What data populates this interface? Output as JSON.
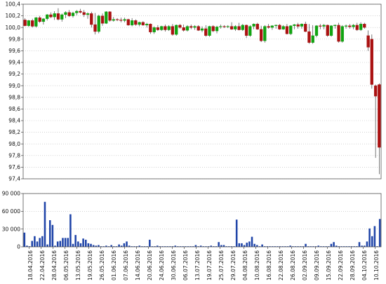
{
  "chart_data": [
    {
      "type": "candlestick",
      "ylim": [
        97.4,
        100.4
      ],
      "yticks": [
        "97,4",
        "97,6",
        "97,8",
        "98,0",
        "98,2",
        "98,4",
        "98,6",
        "98,8",
        "99,0",
        "99,2",
        "99,4",
        "99,6",
        "99,8",
        "100,0",
        "100,2",
        "100,4"
      ],
      "grid": true,
      "up_color": "#11a311",
      "down_color": "#aa1111",
      "candles": [
        {
          "o": 100.13,
          "h": 100.16,
          "l": 100.02,
          "c": 100.03
        },
        {
          "o": 100.03,
          "h": 100.13,
          "l": 100.01,
          "c": 100.12
        },
        {
          "o": 100.12,
          "h": 100.15,
          "l": 100.0,
          "c": 100.02
        },
        {
          "o": 100.02,
          "h": 100.18,
          "l": 100.0,
          "c": 100.17
        },
        {
          "o": 100.17,
          "h": 100.2,
          "l": 100.08,
          "c": 100.1
        },
        {
          "o": 100.1,
          "h": 100.16,
          "l": 100.05,
          "c": 100.15
        },
        {
          "o": 100.15,
          "h": 100.23,
          "l": 100.12,
          "c": 100.22
        },
        {
          "o": 100.22,
          "h": 100.26,
          "l": 100.16,
          "c": 100.18
        },
        {
          "o": 100.18,
          "h": 100.28,
          "l": 100.13,
          "c": 100.24
        },
        {
          "o": 100.24,
          "h": 100.33,
          "l": 100.12,
          "c": 100.14
        },
        {
          "o": 100.14,
          "h": 100.24,
          "l": 100.1,
          "c": 100.22
        },
        {
          "o": 100.22,
          "h": 100.28,
          "l": 100.16,
          "c": 100.26
        },
        {
          "o": 100.26,
          "h": 100.3,
          "l": 100.18,
          "c": 100.2
        },
        {
          "o": 100.2,
          "h": 100.27,
          "l": 100.17,
          "c": 100.25
        },
        {
          "o": 100.25,
          "h": 100.3,
          "l": 100.21,
          "c": 100.28
        },
        {
          "o": 100.28,
          "h": 100.32,
          "l": 100.24,
          "c": 100.26
        },
        {
          "o": 100.26,
          "h": 100.3,
          "l": 100.18,
          "c": 100.22
        },
        {
          "o": 100.22,
          "h": 100.26,
          "l": 100.15,
          "c": 100.24
        },
        {
          "o": 100.24,
          "h": 100.27,
          "l": 100.0,
          "c": 100.05
        },
        {
          "o": 100.05,
          "h": 100.25,
          "l": 99.88,
          "c": 99.93
        },
        {
          "o": 99.93,
          "h": 100.22,
          "l": 99.9,
          "c": 100.2
        },
        {
          "o": 100.2,
          "h": 100.24,
          "l": 100.03,
          "c": 100.07
        },
        {
          "o": 100.07,
          "h": 100.28,
          "l": 100.06,
          "c": 100.27
        },
        {
          "o": 100.27,
          "h": 100.28,
          "l": 100.1,
          "c": 100.12
        },
        {
          "o": 100.12,
          "h": 100.18,
          "l": 100.1,
          "c": 100.14
        },
        {
          "o": 100.14,
          "h": 100.16,
          "l": 100.11,
          "c": 100.13
        },
        {
          "o": 100.13,
          "h": 100.17,
          "l": 100.09,
          "c": 100.12
        },
        {
          "o": 100.12,
          "h": 100.17,
          "l": 100.09,
          "c": 100.14
        },
        {
          "o": 100.14,
          "h": 100.15,
          "l": 100.03,
          "c": 100.04
        },
        {
          "o": 100.04,
          "h": 100.16,
          "l": 100.02,
          "c": 100.12
        },
        {
          "o": 100.12,
          "h": 100.14,
          "l": 100.03,
          "c": 100.05
        },
        {
          "o": 100.05,
          "h": 100.1,
          "l": 100.02,
          "c": 100.09
        },
        {
          "o": 100.09,
          "h": 100.11,
          "l": 100.03,
          "c": 100.04
        },
        {
          "o": 100.04,
          "h": 100.08,
          "l": 100.0,
          "c": 100.06
        },
        {
          "o": 100.06,
          "h": 100.07,
          "l": 99.89,
          "c": 99.92
        },
        {
          "o": 99.92,
          "h": 100.02,
          "l": 99.89,
          "c": 100.0
        },
        {
          "o": 100.0,
          "h": 100.04,
          "l": 99.94,
          "c": 99.96
        },
        {
          "o": 99.96,
          "h": 100.03,
          "l": 99.94,
          "c": 100.02
        },
        {
          "o": 100.02,
          "h": 100.05,
          "l": 99.93,
          "c": 99.96
        },
        {
          "o": 99.96,
          "h": 100.04,
          "l": 99.94,
          "c": 100.02
        },
        {
          "o": 100.02,
          "h": 100.06,
          "l": 99.86,
          "c": 99.88
        },
        {
          "o": 99.88,
          "h": 100.05,
          "l": 99.86,
          "c": 100.04
        },
        {
          "o": 100.04,
          "h": 100.06,
          "l": 99.98,
          "c": 100.0
        },
        {
          "o": 100.0,
          "h": 100.05,
          "l": 99.93,
          "c": 99.95
        },
        {
          "o": 99.95,
          "h": 100.04,
          "l": 99.93,
          "c": 100.02
        },
        {
          "o": 100.02,
          "h": 100.05,
          "l": 99.97,
          "c": 100.0
        },
        {
          "o": 100.0,
          "h": 100.04,
          "l": 99.96,
          "c": 100.02
        },
        {
          "o": 100.02,
          "h": 100.04,
          "l": 99.94,
          "c": 99.95
        },
        {
          "o": 99.95,
          "h": 100.02,
          "l": 99.92,
          "c": 99.98
        },
        {
          "o": 99.98,
          "h": 100.04,
          "l": 99.84,
          "c": 99.86
        },
        {
          "o": 99.86,
          "h": 100.03,
          "l": 99.84,
          "c": 100.02
        },
        {
          "o": 100.02,
          "h": 100.04,
          "l": 99.92,
          "c": 99.94
        },
        {
          "o": 99.94,
          "h": 100.03,
          "l": 99.9,
          "c": 100.01
        },
        {
          "o": 100.01,
          "h": 100.05,
          "l": 99.98,
          "c": 100.02
        },
        {
          "o": 100.02,
          "h": 100.04,
          "l": 99.99,
          "c": 100.01
        },
        {
          "o": 100.01,
          "h": 100.04,
          "l": 99.99,
          "c": 100.02
        },
        {
          "o": 100.02,
          "h": 100.09,
          "l": 99.96,
          "c": 99.97
        },
        {
          "o": 99.97,
          "h": 100.04,
          "l": 99.94,
          "c": 100.02
        },
        {
          "o": 100.02,
          "h": 100.08,
          "l": 99.95,
          "c": 99.96
        },
        {
          "o": 99.96,
          "h": 100.06,
          "l": 99.94,
          "c": 100.04
        },
        {
          "o": 100.04,
          "h": 100.05,
          "l": 99.82,
          "c": 99.86
        },
        {
          "o": 99.86,
          "h": 100.04,
          "l": 99.84,
          "c": 100.02
        },
        {
          "o": 100.02,
          "h": 100.07,
          "l": 99.97,
          "c": 100.06
        },
        {
          "o": 100.06,
          "h": 100.08,
          "l": 99.96,
          "c": 99.97
        },
        {
          "o": 99.97,
          "h": 100.03,
          "l": 99.75,
          "c": 99.77
        },
        {
          "o": 99.77,
          "h": 100.04,
          "l": 99.74,
          "c": 100.02
        },
        {
          "o": 100.02,
          "h": 100.06,
          "l": 99.98,
          "c": 100.0
        },
        {
          "o": 100.0,
          "h": 100.04,
          "l": 99.96,
          "c": 100.03
        },
        {
          "o": 100.03,
          "h": 100.05,
          "l": 99.98,
          "c": 100.04
        },
        {
          "o": 100.04,
          "h": 100.06,
          "l": 99.96,
          "c": 99.97
        },
        {
          "o": 99.97,
          "h": 100.04,
          "l": 99.96,
          "c": 100.02
        },
        {
          "o": 100.02,
          "h": 100.06,
          "l": 99.88,
          "c": 99.89
        },
        {
          "o": 99.89,
          "h": 100.04,
          "l": 99.87,
          "c": 100.03
        },
        {
          "o": 100.03,
          "h": 100.06,
          "l": 99.97,
          "c": 100.05
        },
        {
          "o": 100.05,
          "h": 100.08,
          "l": 99.98,
          "c": 100.02
        },
        {
          "o": 100.02,
          "h": 100.07,
          "l": 99.98,
          "c": 100.06
        },
        {
          "o": 100.06,
          "h": 100.1,
          "l": 99.92,
          "c": 99.93
        },
        {
          "o": 99.93,
          "h": 100.06,
          "l": 99.72,
          "c": 99.74
        },
        {
          "o": 99.74,
          "h": 100.04,
          "l": 99.72,
          "c": 99.86
        },
        {
          "o": 99.86,
          "h": 100.04,
          "l": 99.83,
          "c": 100.03
        },
        {
          "o": 100.03,
          "h": 100.06,
          "l": 99.97,
          "c": 100.02
        },
        {
          "o": 100.02,
          "h": 100.06,
          "l": 99.97,
          "c": 100.04
        },
        {
          "o": 100.04,
          "h": 100.05,
          "l": 99.84,
          "c": 99.86
        },
        {
          "o": 99.86,
          "h": 100.04,
          "l": 99.84,
          "c": 100.03
        },
        {
          "o": 100.03,
          "h": 100.05,
          "l": 99.98,
          "c": 100.04
        },
        {
          "o": 100.04,
          "h": 100.08,
          "l": 99.74,
          "c": 99.76
        },
        {
          "o": 99.76,
          "h": 100.04,
          "l": 99.74,
          "c": 100.02
        },
        {
          "o": 100.02,
          "h": 100.05,
          "l": 99.98,
          "c": 100.03
        },
        {
          "o": 100.03,
          "h": 100.06,
          "l": 99.98,
          "c": 100.01
        },
        {
          "o": 100.01,
          "h": 100.06,
          "l": 99.97,
          "c": 100.04
        },
        {
          "o": 100.04,
          "h": 100.08,
          "l": 99.94,
          "c": 99.96
        },
        {
          "o": 99.96,
          "h": 100.09,
          "l": 99.94,
          "c": 100.06
        },
        {
          "o": 100.06,
          "h": 100.08,
          "l": 99.98,
          "c": 100.0
        },
        {
          "o": 99.86,
          "h": 99.95,
          "l": 99.6,
          "c": 99.66
        },
        {
          "o": 99.8,
          "h": 99.88,
          "l": 98.95,
          "c": 99.02
        },
        {
          "o": 99.0,
          "h": 99.02,
          "l": 97.76,
          "c": 98.82
        },
        {
          "o": 99.02,
          "h": 99.04,
          "l": 97.48,
          "c": 97.94
        }
      ]
    },
    {
      "type": "bar",
      "ylim": [
        0,
        90000
      ],
      "yticks": [
        "0",
        "30 000",
        "60 000",
        "90 000"
      ],
      "grid": true,
      "bar_color": "#1f44a8",
      "values": [
        24000,
        2000,
        1000,
        10000,
        18000,
        9000,
        15000,
        18000,
        76000,
        4000,
        45000,
        37000,
        2000,
        9000,
        10000,
        15000,
        15000,
        15000,
        55000,
        5000,
        20000,
        9000,
        6000,
        14000,
        12000,
        6000,
        5000,
        3000,
        2000,
        3000,
        1000,
        1000,
        2000,
        1000,
        3000,
        1000,
        1000,
        4000,
        2000,
        6000,
        9000,
        2000,
        1000,
        1000,
        1000,
        2000,
        1000,
        1000,
        1000,
        12000,
        1000,
        1000,
        2000,
        1000,
        1000,
        1000,
        1000,
        1000,
        1000,
        2000,
        1000,
        1000,
        1000,
        1000,
        1000,
        1000,
        1000,
        3000,
        1000,
        2000,
        1000,
        1000,
        1000,
        2000,
        1000,
        1000,
        8000,
        3000,
        3000,
        1000,
        1000,
        1000,
        1000,
        46000,
        6000,
        6000,
        3000,
        7000,
        9000,
        17000,
        5000,
        3000,
        1000,
        4000,
        1000,
        1000,
        1000,
        1000,
        1000,
        1000,
        1000,
        1000,
        1000,
        1000,
        2000,
        1000,
        1000,
        1000,
        1000,
        1000,
        5000,
        1000,
        1000,
        1000,
        1000,
        2000,
        1000,
        1000,
        1000,
        1000,
        5000,
        8000,
        2000,
        1000,
        1000,
        1000,
        1000,
        1000,
        1000,
        1000,
        1000,
        8000,
        2000,
        2000,
        9000,
        31000,
        18000,
        35000,
        1000,
        47000
      ],
      "date_labels": [
        "18.04.2016",
        "22.04.2016",
        "28.04.2016",
        "06.05.2016",
        "13.05.2016",
        "19.05.2016",
        "26.05.2016",
        "01.06.2016",
        "07.06.2016",
        "14.06.2016",
        "20.06.2016",
        "24.06.2016",
        "30.06.2016",
        "06.07.2016",
        "13.07.2016",
        "19.07.2016",
        "25.07.2016",
        "29.07.2016",
        "04.08.2016",
        "10.08.2016",
        "16.08.2016",
        "22.08.2016",
        "26.08.2016",
        "02.09.2016",
        "09.09.2016",
        "15.09.2016",
        "22.09.2016",
        "28.09.2016",
        "04.10.2016",
        "10.10.2016"
      ]
    }
  ]
}
